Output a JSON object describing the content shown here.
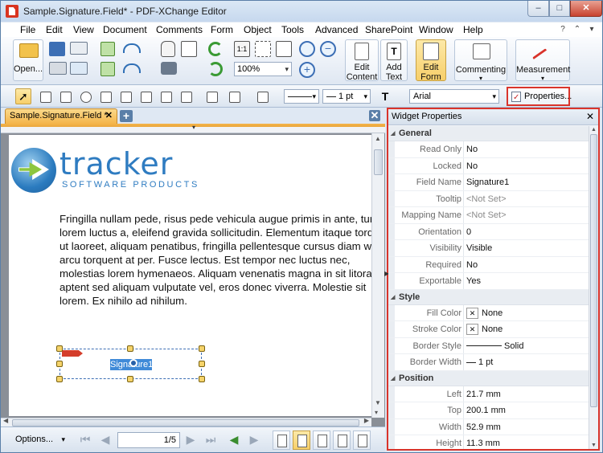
{
  "window": {
    "title": "Sample.Signature.Field* - PDF-XChange Editor",
    "min": "–",
    "max": "□",
    "close": "✕"
  },
  "menu": [
    {
      "id": "file",
      "label": "File"
    },
    {
      "id": "edit",
      "label": "Edit"
    },
    {
      "id": "view",
      "label": "View"
    },
    {
      "id": "document",
      "label": "Document"
    },
    {
      "id": "comments",
      "label": "Comments"
    },
    {
      "id": "form",
      "label": "Form"
    },
    {
      "id": "object",
      "label": "Object"
    },
    {
      "id": "tools",
      "label": "Tools"
    },
    {
      "id": "advanced",
      "label": "Advanced"
    },
    {
      "id": "sharepoint",
      "label": "SharePoint"
    },
    {
      "id": "window",
      "label": "Window"
    },
    {
      "id": "help",
      "label": "Help"
    }
  ],
  "ribbon": {
    "open": "Open...",
    "zoom": "100%",
    "edit_content": [
      "Edit",
      "Content"
    ],
    "add_text": [
      "Add",
      "Text"
    ],
    "edit_form": [
      "Edit",
      "Form"
    ],
    "commenting": "Commenting",
    "measurement": "Measurement"
  },
  "formbar": {
    "line_width": "1 pt",
    "font": "Arial",
    "properties": "Properties..."
  },
  "tabs": {
    "doc_tab": "Sample.Signature.Field *",
    "new_tab": "+",
    "close": "✕"
  },
  "document": {
    "logo_text": "tracker",
    "logo_sub": "SOFTWARE PRODUCTS",
    "paragraph": "Fringilla nullam pede, risus pede vehicula augue primis in ante, turp\nlorem luctus a, eleifend gravida sollicitudin. Elementum itaque tord\nut laoreet, aliquam penatibus, fringilla pellentesque cursus diam w\narcu torquent at per. Fusce lectus. Est tempor nec luctus nec,\nmolestias lorem hymenaeos. Aliquam venenatis magna in sit litora\naptent sed aliquam vulputate vel, eros donec viverra. Molestie sit\nlorem. Ex nihilo ad nihilum.",
    "field_name": "Signature1"
  },
  "status": {
    "options": "Options...",
    "page": "1/5"
  },
  "panel": {
    "title": "Widget Properties",
    "close": "✕",
    "sections": [
      {
        "name": "General",
        "rows": [
          {
            "key": "Read Only",
            "value": "No"
          },
          {
            "key": "Locked",
            "value": "No"
          },
          {
            "key": "Field Name",
            "value": "Signature1"
          },
          {
            "key": "Tooltip",
            "value": "<Not Set>",
            "placeholder": true
          },
          {
            "key": "Mapping Name",
            "value": "<Not Set>",
            "placeholder": true
          },
          {
            "key": "Orientation",
            "value": "0"
          },
          {
            "key": "Visibility",
            "value": "Visible"
          },
          {
            "key": "Required",
            "value": "No"
          },
          {
            "key": "Exportable",
            "value": "Yes"
          }
        ]
      },
      {
        "name": "Style",
        "rows": [
          {
            "key": "Fill Color",
            "value": "None",
            "swatch": true
          },
          {
            "key": "Stroke Color",
            "value": "None",
            "swatch": true
          },
          {
            "key": "Border Style",
            "value": "Solid",
            "line": "long"
          },
          {
            "key": "Border Width",
            "value": "1 pt",
            "line": "short"
          }
        ]
      },
      {
        "name": "Position",
        "rows": [
          {
            "key": "Left",
            "value": "21.7 mm"
          },
          {
            "key": "Top",
            "value": "200.1 mm"
          },
          {
            "key": "Width",
            "value": "52.9 mm"
          },
          {
            "key": "Height",
            "value": "11.3 mm"
          }
        ]
      }
    ]
  },
  "colors": {
    "highlight": "#d9342b",
    "accent": "#f4b54a",
    "logo_blue": "#2f7cc1",
    "logo_green": "#8dc63f"
  }
}
